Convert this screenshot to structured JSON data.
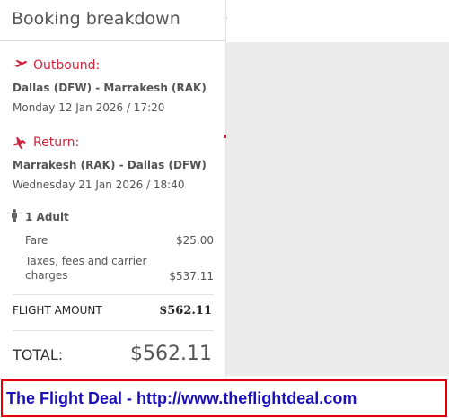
{
  "panel": {
    "title": "Booking breakdown"
  },
  "outbound": {
    "label": "Outbound:",
    "route": "Dallas (DFW) - Marrakesh (RAK)",
    "datetime": "Monday 12 Jan 2026 / 17:20",
    "icon": "plane-takeoff-icon"
  },
  "return": {
    "label": "Return:",
    "route": "Marrakesh (RAK) - Dallas (DFW)",
    "datetime": "Wednesday 21 Jan 2026 / 18:40",
    "icon": "plane-landing-icon"
  },
  "passengers": {
    "label": "1 Adult",
    "icon": "person-icon",
    "fare_label": "Fare",
    "fare_value": "$25.00",
    "taxes_label_line1": "Taxes, fees and carrier",
    "taxes_label_line2": "charges",
    "taxes_value": "$537.11"
  },
  "flight_amount": {
    "label": "FLIGHT AMOUNT",
    "value": "$562.11"
  },
  "total": {
    "label": "TOTAL:",
    "value": "$562.11"
  },
  "banner": {
    "text": "The Flight Deal - http://www.theflightdeal.com"
  },
  "colors": {
    "accent": "#d0233c",
    "banner_text": "#1b0fb8",
    "banner_border": "#e60000",
    "panel_bg": "#ececec"
  }
}
